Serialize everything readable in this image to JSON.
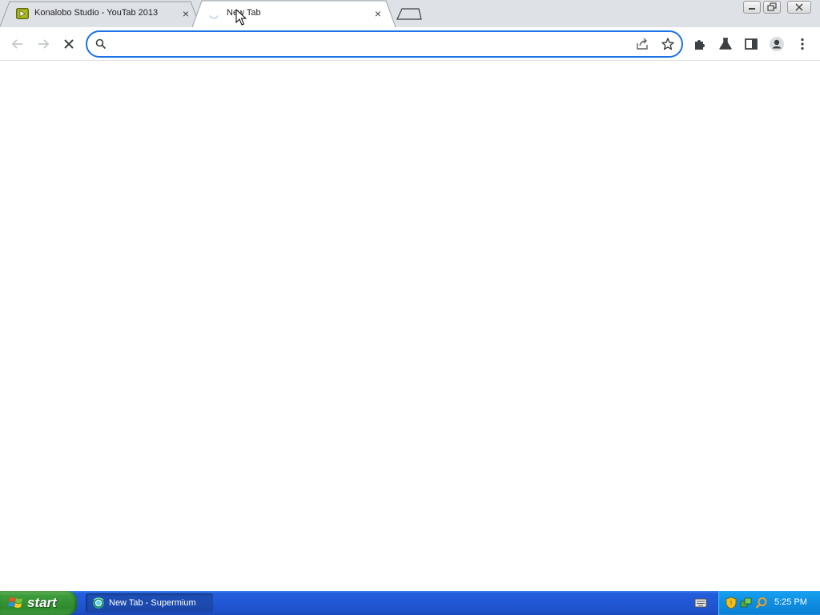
{
  "browser": {
    "tabs": [
      {
        "title": "Konalobo Studio - YouTab 2013",
        "favicon": "youtab-play-icon",
        "active": false
      },
      {
        "title": "New Tab",
        "favicon": "loading-spinner-icon",
        "active": true
      }
    ],
    "close_glyph": "×",
    "omnibox": {
      "value": "",
      "placeholder": ""
    }
  },
  "taskbar": {
    "start_label": "start",
    "task_item_label": "New Tab - Supermium",
    "clock": "5:25 PM"
  },
  "colors": {
    "tabstrip": "#dee1e6",
    "omnibox_focus": "#1a73e8",
    "taskbar_blue": "#245edb",
    "start_green": "#3c9c3a",
    "tray_blue": "#0f8de0"
  }
}
